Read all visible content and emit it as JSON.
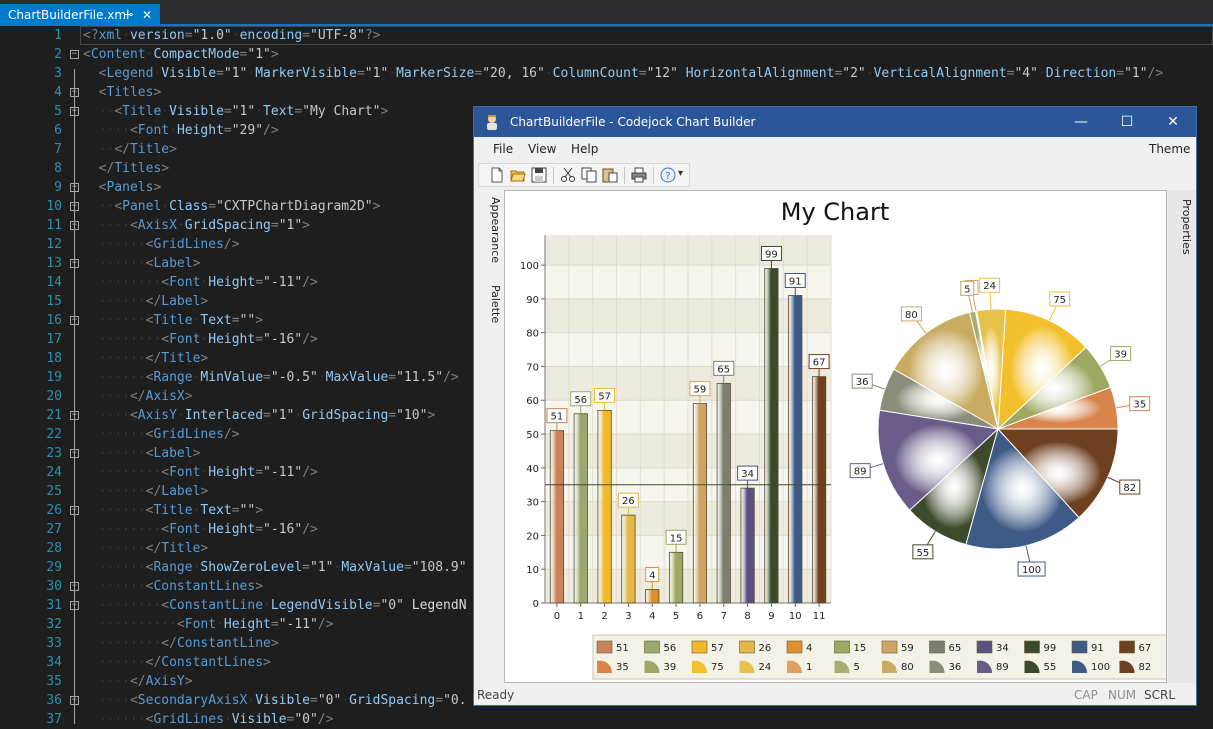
{
  "tab": {
    "filename": "ChartBuilderFile.xml",
    "pin_glyph": "⊸",
    "close_glyph": "✕"
  },
  "code_lines": [
    {
      "n": "1",
      "text": "<?xml version=\"1.0\" encoding=\"UTF-8\"?>"
    },
    {
      "n": "2",
      "text": "<Content CompactMode=\"1\">"
    },
    {
      "n": "3",
      "text": "  <Legend Visible=\"1\" MarkerVisible=\"1\" MarkerSize=\"20, 16\" ColumnCount=\"12\" HorizontalAlignment=\"2\" VerticalAlignment=\"4\" Direction=\"1\"/>"
    },
    {
      "n": "4",
      "text": "  <Titles>"
    },
    {
      "n": "5",
      "text": "    <Title Visible=\"1\" Text=\"My Chart\">"
    },
    {
      "n": "6",
      "text": "      <Font Height=\"29\"/>"
    },
    {
      "n": "7",
      "text": "    </Title>"
    },
    {
      "n": "8",
      "text": "  </Titles>"
    },
    {
      "n": "9",
      "text": "  <Panels>"
    },
    {
      "n": "10",
      "text": "    <Panel Class=\"CXTPChartDiagram2D\">"
    },
    {
      "n": "11",
      "text": "      <AxisX GridSpacing=\"1\">"
    },
    {
      "n": "12",
      "text": "        <GridLines/>"
    },
    {
      "n": "13",
      "text": "        <Label>"
    },
    {
      "n": "14",
      "text": "          <Font Height=\"-11\"/>"
    },
    {
      "n": "15",
      "text": "        </Label>"
    },
    {
      "n": "16",
      "text": "        <Title Text=\"\">"
    },
    {
      "n": "17",
      "text": "          <Font Height=\"-16\"/>"
    },
    {
      "n": "18",
      "text": "        </Title>"
    },
    {
      "n": "19",
      "text": "        <Range MinValue=\"-0.5\" MaxValue=\"11.5\"/>"
    },
    {
      "n": "20",
      "text": "      </AxisX>"
    },
    {
      "n": "21",
      "text": "      <AxisY Interlaced=\"1\" GridSpacing=\"10\">"
    },
    {
      "n": "22",
      "text": "        <GridLines/>"
    },
    {
      "n": "23",
      "text": "        <Label>"
    },
    {
      "n": "24",
      "text": "          <Font Height=\"-11\"/>"
    },
    {
      "n": "25",
      "text": "        </Label>"
    },
    {
      "n": "26",
      "text": "        <Title Text=\"\">"
    },
    {
      "n": "27",
      "text": "          <Font Height=\"-16\"/>"
    },
    {
      "n": "28",
      "text": "        </Title>"
    },
    {
      "n": "29",
      "text": "        <Range ShowZeroLevel=\"1\" MaxValue=\"108.9\""
    },
    {
      "n": "30",
      "text": "        <ConstantLines>"
    },
    {
      "n": "31",
      "text": "          <ConstantLine LegendVisible=\"0\" LegendN"
    },
    {
      "n": "32",
      "text": "            <Font Height=\"-11\"/>"
    },
    {
      "n": "33",
      "text": "          </ConstantLine>"
    },
    {
      "n": "34",
      "text": "        </ConstantLines>"
    },
    {
      "n": "35",
      "text": "      </AxisY>"
    },
    {
      "n": "36",
      "text": "      <SecondaryAxisX Visible=\"0\" GridSpacing=\"0."
    },
    {
      "n": "37",
      "text": "        <GridLines Visible=\"0\"/>"
    }
  ],
  "window": {
    "title": "ChartBuilderFile - Codejock Chart Builder",
    "minimize": "—",
    "maximize": "☐",
    "close": "✕",
    "menu": [
      "File",
      "View",
      "Help"
    ],
    "theme_label": "Theme",
    "left_tabs": [
      "Appearance",
      "Palette"
    ],
    "right_tab": "Properties",
    "status": {
      "ready": "Ready",
      "cap": "CAP",
      "num": "NUM",
      "scrl": "SCRL"
    },
    "toolbar_icons": [
      "new-icon",
      "open-icon",
      "save-icon",
      "cut-icon",
      "copy-icon",
      "paste-icon",
      "print-icon",
      "help-icon"
    ],
    "help_dropdown_glyph": "▾"
  },
  "chart_data": [
    {
      "type": "bar",
      "title": "My Chart",
      "categories": [
        "0",
        "1",
        "2",
        "3",
        "4",
        "5",
        "6",
        "7",
        "8",
        "9",
        "10",
        "11"
      ],
      "values": [
        51,
        56,
        57,
        26,
        4,
        15,
        59,
        65,
        34,
        99,
        91,
        67
      ],
      "ylim": [
        0,
        108.9
      ],
      "yticks": [
        0,
        10,
        20,
        30,
        40,
        50,
        60,
        70,
        80,
        90,
        100
      ],
      "constant_line": 35,
      "interlaced": true,
      "colors": [
        "#c8835a",
        "#9aa870",
        "#f0b82a",
        "#e2b848",
        "#e0902a",
        "#9ea862",
        "#cda665",
        "#7c7f6e",
        "#5a4f82",
        "#3a4a2a",
        "#3e5a86",
        "#6e4020"
      ]
    },
    {
      "type": "pie",
      "values": [
        35,
        39,
        75,
        24,
        1,
        5,
        80,
        36,
        89,
        55,
        100,
        82
      ],
      "colors": [
        "#d8844a",
        "#9ea862",
        "#f2c02c",
        "#e6c24a",
        "#e0a060",
        "#a8ad70",
        "#c9ab62",
        "#8a8d7a",
        "#6a5c88",
        "#3e4a2c",
        "#3e5a86",
        "#6e4020"
      ]
    }
  ],
  "legend": {
    "row1": [
      {
        "color": "#c8835a",
        "v": "51"
      },
      {
        "color": "#9aa870",
        "v": "56"
      },
      {
        "color": "#f0b82a",
        "v": "57"
      },
      {
        "color": "#e2b848",
        "v": "26"
      },
      {
        "color": "#e0902a",
        "v": "4"
      },
      {
        "color": "#9ea862",
        "v": "15"
      },
      {
        "color": "#cda665",
        "v": "59"
      },
      {
        "color": "#7c7f6e",
        "v": "65"
      },
      {
        "color": "#5a4f82",
        "v": "34"
      },
      {
        "color": "#3a4a2a",
        "v": "99"
      },
      {
        "color": "#3e5a86",
        "v": "91"
      },
      {
        "color": "#6e4020",
        "v": "67"
      }
    ],
    "row2": [
      {
        "color": "#d8844a",
        "v": "35"
      },
      {
        "color": "#9ea862",
        "v": "39"
      },
      {
        "color": "#f2c02c",
        "v": "75"
      },
      {
        "color": "#e6c24a",
        "v": "24"
      },
      {
        "color": "#e0a060",
        "v": "1"
      },
      {
        "color": "#a8ad70",
        "v": "5"
      },
      {
        "color": "#c9ab62",
        "v": "80"
      },
      {
        "color": "#8a8d7a",
        "v": "36"
      },
      {
        "color": "#6a5c88",
        "v": "89"
      },
      {
        "color": "#3e4a2c",
        "v": "55"
      },
      {
        "color": "#3e5a86",
        "v": "100"
      },
      {
        "color": "#6e4020",
        "v": "82"
      }
    ]
  }
}
